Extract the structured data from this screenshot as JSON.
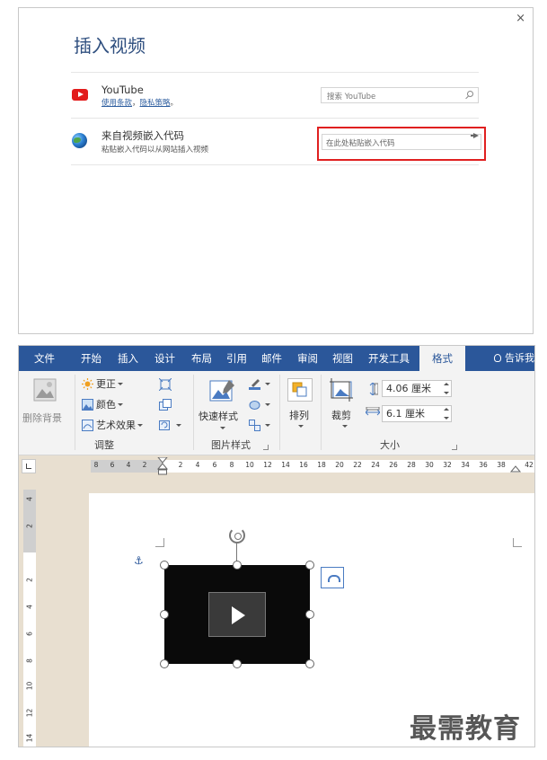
{
  "dialog": {
    "title": "插入视频",
    "close": "×",
    "youtube": {
      "name": "YouTube",
      "terms_link": "使用条款",
      "privacy_link": "隐私策略",
      "separator": "。",
      "search_placeholder": "搜索 YouTube"
    },
    "embed": {
      "name": "来自视频嵌入代码",
      "desc": "粘贴嵌入代码以从网站插入视频",
      "input_placeholder": "在此处粘贴嵌入代码"
    },
    "colors": {
      "title": "#2f4f7f",
      "highlight": "#e02020",
      "youtube": "#e21b1b"
    }
  },
  "word": {
    "tabs": [
      "文件",
      "开始",
      "插入",
      "设计",
      "布局",
      "引用",
      "邮件",
      "审阅",
      "视图",
      "开发工具"
    ],
    "active_tab": "格式",
    "tell_me": "告诉我",
    "ribbon": {
      "remove_bg": "删除背景",
      "corrections": "更正",
      "color": "颜色",
      "artistic": "艺术效果",
      "adjust_group": "调整",
      "quick_styles": "快速样式",
      "picture_styles_group": "图片样式",
      "arrange": "排列",
      "crop": "裁剪",
      "height_value": "4.06 厘米",
      "width_value": "6.1 厘米",
      "size_group": "大小"
    },
    "hruler_ticks": [
      "8",
      "6",
      "4",
      "2",
      "",
      "2",
      "4",
      "6",
      "8",
      "10",
      "12",
      "14",
      "16",
      "18",
      "20",
      "22",
      "24",
      "26",
      "28",
      "30",
      "32",
      "34",
      "36",
      "38",
      "",
      "42"
    ],
    "vruler_ticks": [
      "4",
      "2",
      "",
      "2",
      "4",
      "6",
      "8",
      "10",
      "12",
      "14"
    ],
    "colors": {
      "tabbar": "#2b579a",
      "ribbon_bg": "#f3f3f3",
      "canvas_bg": "#e8dfd0"
    }
  },
  "watermark": "最需教育"
}
